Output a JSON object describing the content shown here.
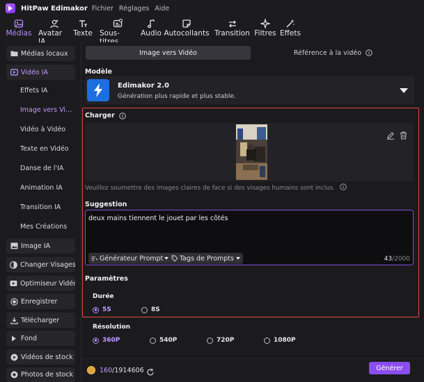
{
  "app": {
    "title": "HitPaw Edimakor",
    "menu": [
      "Fichier",
      "Réglages",
      "Aide"
    ]
  },
  "toolbar": {
    "items": [
      {
        "label": "Médias",
        "icon": "media-icon",
        "active": true
      },
      {
        "label": "Avatar IA",
        "icon": "avatar-icon"
      },
      {
        "label": "Texte",
        "icon": "text-icon"
      },
      {
        "label": "Sous-titres",
        "icon": "subtitles-icon"
      },
      {
        "label": "Audio",
        "icon": "music-note-icon"
      },
      {
        "label": "Autocollants",
        "icon": "sticker-icon"
      },
      {
        "label": "Transition",
        "icon": "transition-arrows-icon"
      },
      {
        "label": "Filtres",
        "icon": "filter-sparkle-icon"
      },
      {
        "label": "Effets",
        "icon": "effects-wand-icon"
      }
    ]
  },
  "sidebar": {
    "items": [
      {
        "label": "Médias locaux",
        "icon": "folder-icon"
      },
      {
        "label": "Vidéo IA",
        "icon": "ai-video-icon",
        "active": true
      },
      {
        "label": "Image IA",
        "icon": "image-icon"
      },
      {
        "label": "Changer Visages",
        "icon": "face-swap-icon"
      },
      {
        "label": "Optimiseur Vidéo",
        "icon": "video-enhance-icon"
      },
      {
        "label": "Enregistrer",
        "icon": "record-icon"
      },
      {
        "label": "Télécharger",
        "icon": "download-icon"
      },
      {
        "label": "Fond",
        "icon": "play-triangle-icon"
      },
      {
        "label": "Vidéos de stock",
        "icon": "stock-video-icon"
      },
      {
        "label": "Photos de stock",
        "icon": "stock-photo-icon"
      }
    ],
    "subitems": [
      {
        "label": "Effets IA"
      },
      {
        "label": "Image vers Vidéo",
        "active": true
      },
      {
        "label": "Vidéo à Vidéo"
      },
      {
        "label": "Texte en Vidéo"
      },
      {
        "label": "Danse de l'IA"
      },
      {
        "label": "Animation IA"
      },
      {
        "label": "Transition IA"
      },
      {
        "label": "Mes Créations"
      }
    ]
  },
  "main": {
    "tabs": [
      {
        "label": "Image vers Vidéo",
        "active": true
      },
      {
        "label": "Référence à la vidéo"
      }
    ],
    "model": {
      "section": "Modèle",
      "name": "Edimakor 2.0",
      "desc": "Génération plus rapide et plus stable."
    },
    "upload": {
      "section": "Charger",
      "hint": "Veuillez soumettre des images claires de face si des visages humains sont inclus."
    },
    "suggestion": {
      "section": "Suggestion",
      "text": "deux mains tiennent le jouet par les côtés",
      "generator_btn": "Générateur Prompt",
      "tags_btn": "Tags de Prompts",
      "count": "43",
      "max": "/2000"
    },
    "params": {
      "section": "Paramètres",
      "duration_label": "Durée",
      "durations": [
        "5S",
        "8S"
      ],
      "duration_selected": "5S",
      "resolution_label": "Résolution",
      "resolutions": [
        "360P",
        "540P",
        "720P",
        "1080P"
      ],
      "resolution_selected": "360P"
    },
    "footer": {
      "credits_used": "160",
      "credits_total": "/1914606",
      "generate": "Générer"
    }
  },
  "colors": {
    "accent": "#b58cff",
    "highlight_border": "#e8483c",
    "generate_button": "#8a4df0",
    "model_icon": "#1d6fe0"
  }
}
